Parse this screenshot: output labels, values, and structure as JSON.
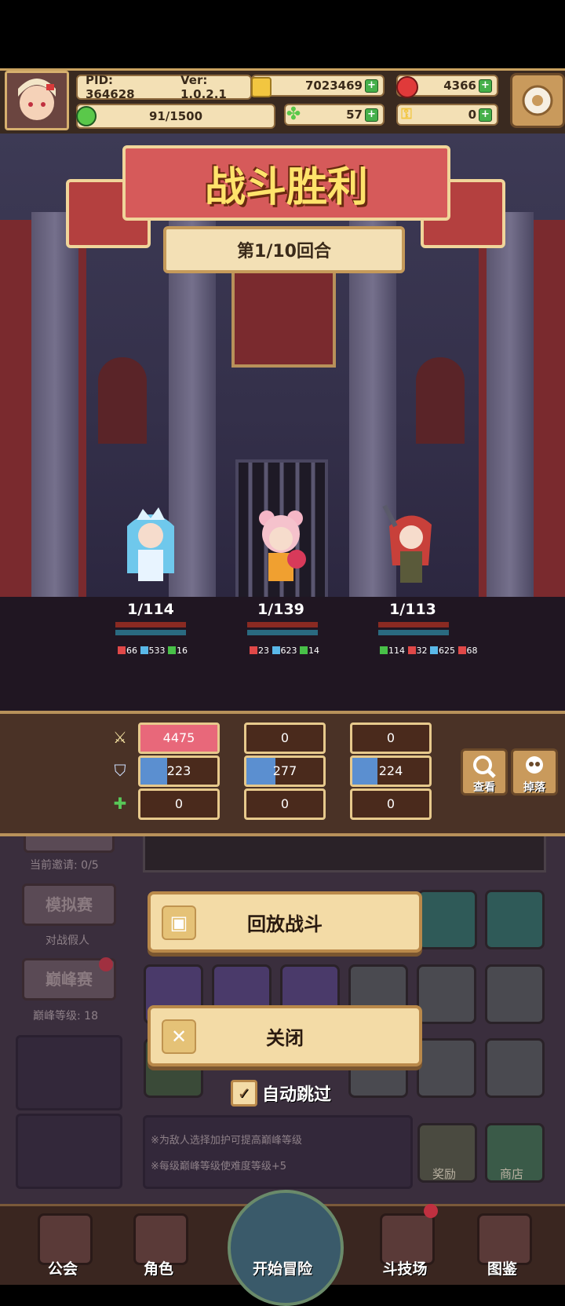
{
  "header": {
    "pid": "PID: 364628",
    "version": "Ver: 1.0.2.1",
    "gold": "7023469",
    "gems": "4366",
    "stamina": "91/1500",
    "clover": "57",
    "keys": "0"
  },
  "banner": {
    "title": "战斗胜利",
    "round": "第1/10回合"
  },
  "heroes": [
    {
      "hp": "1/114",
      "stats": [
        "66",
        "533",
        "16"
      ]
    },
    {
      "hp": "1/139",
      "stats": [
        "23",
        "623",
        "14"
      ]
    },
    {
      "hp": "1/113",
      "stats": [
        "114",
        "32",
        "625",
        "68"
      ]
    }
  ],
  "stats_table": {
    "damage": [
      "4475",
      "0",
      "0"
    ],
    "shield": [
      "223",
      "277",
      "224"
    ],
    "heal": [
      "0",
      "0",
      "0"
    ],
    "shield_fill": [
      0.35,
      0.38,
      0.33
    ]
  },
  "side_buttons": {
    "view": "查看",
    "drops": "掉落"
  },
  "background_menu": {
    "invite_count": "当前邀请: 0/5",
    "sim_label": "模拟赛",
    "sim_sub": "对战假人",
    "peak_label": "巅峰赛",
    "peak_sub": "巅峰等级: 18",
    "hint1": "※为敌人选择加护可提高巅峰等级",
    "hint2": "※每级巅峰等级使难度等级+5",
    "reward": "奖励",
    "shop": "商店"
  },
  "dialog": {
    "replay": "回放战斗",
    "close": "关闭",
    "auto_skip": "自动跳过",
    "auto_skip_checked": true
  },
  "nav": {
    "guild": "公会",
    "character": "角色",
    "adventure": "开始冒险",
    "arena": "斗技场",
    "codex": "图鉴"
  },
  "colors": {
    "damage_fill": "#e8687a",
    "shield_fill": "#5b8fd0",
    "gold_accent": "#f0d59a",
    "victory_text": "#ffe36b"
  }
}
